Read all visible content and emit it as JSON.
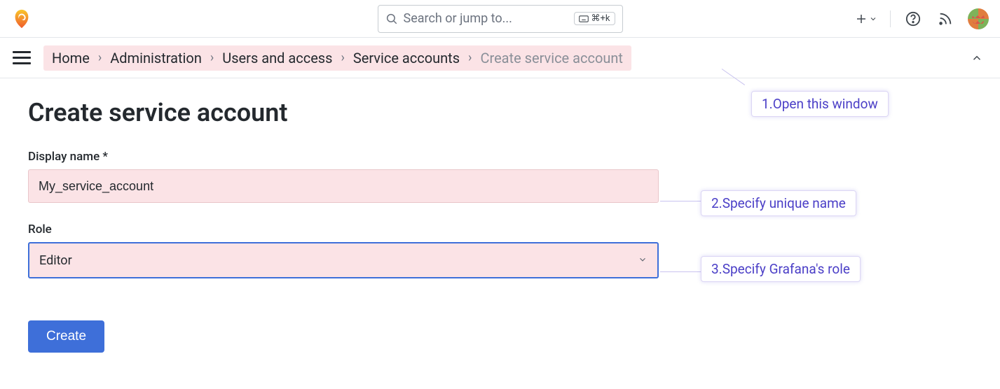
{
  "topbar": {
    "search_placeholder": "Search or jump to...",
    "shortcut": "⌘+k"
  },
  "breadcrumb": {
    "items": [
      "Home",
      "Administration",
      "Users and access",
      "Service accounts"
    ],
    "current": "Create service account"
  },
  "page": {
    "title": "Create service account",
    "display_name_label": "Display name *",
    "display_name_value": "My_service_account",
    "role_label": "Role",
    "role_value": "Editor",
    "create_label": "Create"
  },
  "annotations": {
    "a1": "1.Open this window",
    "a2": "2.Specify unique name",
    "a3": "3.Specify Grafana's role"
  }
}
